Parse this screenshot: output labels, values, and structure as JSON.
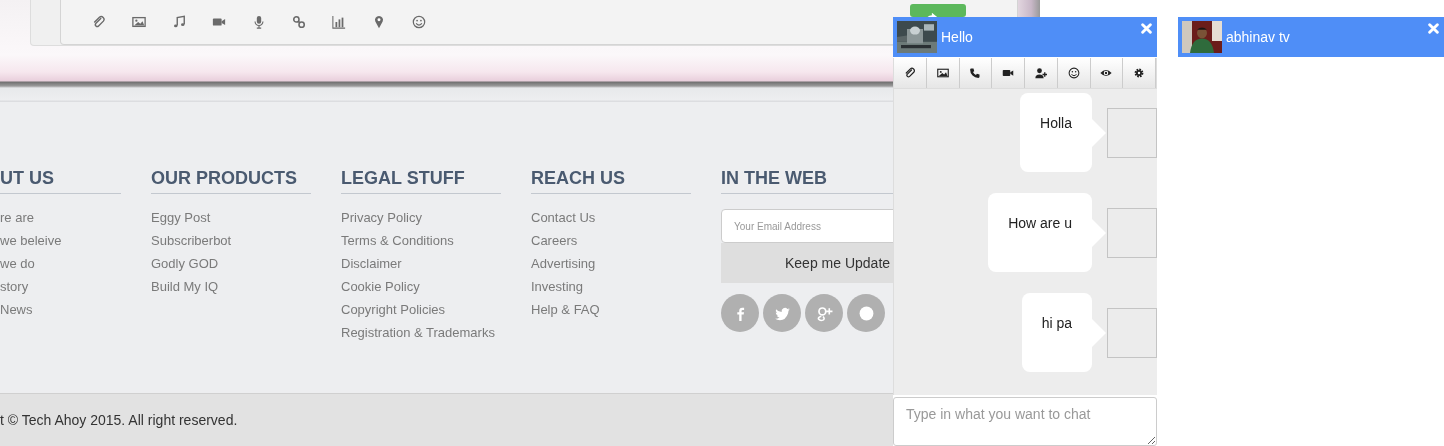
{
  "footer": {
    "columns": [
      {
        "heading": "UT US",
        "links": [
          "re are",
          "we beleive",
          "we do",
          "story",
          "News"
        ]
      },
      {
        "heading": "OUR PRODUCTS",
        "links": [
          "Eggy Post",
          "Subscriberbot",
          "Godly GOD",
          "Build My IQ"
        ]
      },
      {
        "heading": "LEGAL STUFF",
        "links": [
          "Privacy Policy",
          "Terms & Conditions",
          "Disclaimer",
          "Cookie Policy",
          "Copyright Policies",
          "Registration & Trademarks"
        ]
      },
      {
        "heading": "REACH US",
        "links": [
          "Contact Us",
          "Careers",
          "Advertising",
          "Investing",
          "Help & FAQ"
        ]
      }
    ],
    "web": {
      "heading": "IN THE WEB",
      "email_placeholder": "Your Email Address",
      "button": "Keep me Update"
    },
    "copyright": "t © Tech Ahoy 2015. All right reserved."
  },
  "chats": [
    {
      "title": "Hello",
      "messages": [
        {
          "text": "Holla"
        },
        {
          "text": "How are u"
        },
        {
          "text": "hi pa"
        }
      ],
      "input_placeholder": "Type in what you want to chat"
    },
    {
      "title": "abhinav tv"
    }
  ]
}
